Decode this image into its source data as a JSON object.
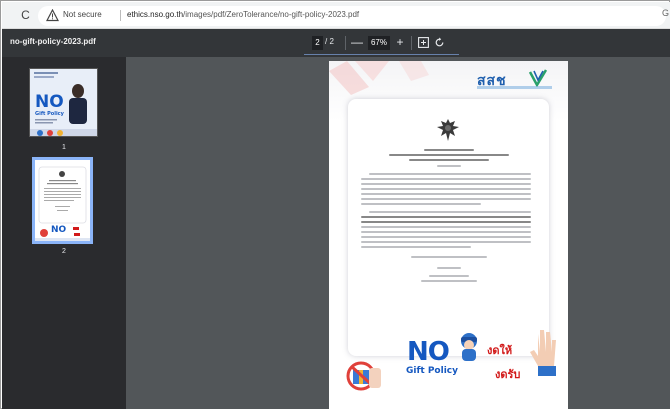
{
  "browser": {
    "reload_icon": "reload-icon",
    "security_label": "Not secure",
    "url_host": "ethics.nso.go.th",
    "url_path": "/images/pdf/ZeroTolerance/no-gift-policy-2023.pdf"
  },
  "pdf_toolbar": {
    "file_name": "no-gift-policy-2023.pdf",
    "current_page": "2",
    "page_total_text": "/  2",
    "zoom_out_label": "—",
    "zoom_level": "67%",
    "zoom_in_label": "+"
  },
  "sidebar": {
    "thumbnails": [
      {
        "label": "1",
        "selected": false
      },
      {
        "label": "2",
        "selected": true
      }
    ]
  },
  "page": {
    "logo_text": "สสช",
    "banner_no": "NO",
    "banner_gift_policy": "Gift Policy",
    "banner_thai_1": "งดให้",
    "banner_thai_2": "งดรับ"
  },
  "colors": {
    "accent_blue": "#1558c0",
    "warning_red": "#d21a1a",
    "viewer_bg": "#525659",
    "toolbar_bg": "#333639",
    "sidebar_bg": "#2a2b2e",
    "selection": "#8ab4f8"
  }
}
